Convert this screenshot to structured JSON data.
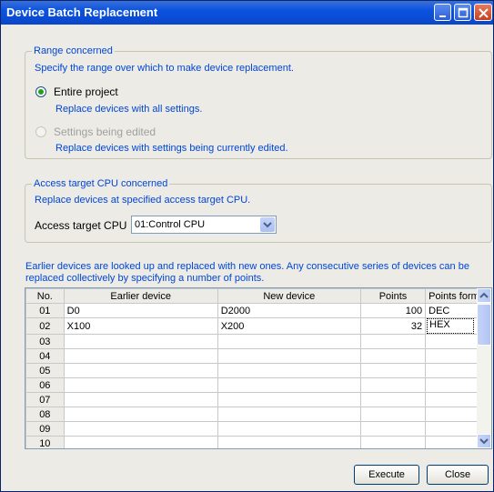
{
  "window": {
    "title": "Device Batch Replacement"
  },
  "range_group": {
    "legend": "Range concerned",
    "description": "Specify the range over which to make device replacement.",
    "options": [
      {
        "label": "Entire project",
        "hint": "Replace devices with all settings.",
        "selected": true,
        "enabled": true
      },
      {
        "label": "Settings being edited",
        "hint": "Replace devices with settings being currently edited.",
        "selected": false,
        "enabled": false
      }
    ]
  },
  "cpu_group": {
    "legend": "Access target CPU concerned",
    "description": "Replace devices at specified access target CPU.",
    "field_label": "Access target CPU",
    "selected_value": "01:Control CPU"
  },
  "instructions": {
    "line1": "Earlier devices are looked up and replaced with new ones. Any consecutive series of devices can be",
    "line2": "replaced collectively by specifying a number of points."
  },
  "table": {
    "columns": [
      "No.",
      "Earlier device",
      "New device",
      "Points",
      "Points format"
    ],
    "rows": [
      {
        "no": "01",
        "earlier": "D0",
        "new": "D2000",
        "points": "100",
        "format": "DEC"
      },
      {
        "no": "02",
        "earlier": "X100",
        "new": "X200",
        "points": "32",
        "format": "HEX"
      },
      {
        "no": "03",
        "earlier": "",
        "new": "",
        "points": "",
        "format": ""
      },
      {
        "no": "04",
        "earlier": "",
        "new": "",
        "points": "",
        "format": ""
      },
      {
        "no": "05",
        "earlier": "",
        "new": "",
        "points": "",
        "format": ""
      },
      {
        "no": "06",
        "earlier": "",
        "new": "",
        "points": "",
        "format": ""
      },
      {
        "no": "07",
        "earlier": "",
        "new": "",
        "points": "",
        "format": ""
      },
      {
        "no": "08",
        "earlier": "",
        "new": "",
        "points": "",
        "format": ""
      },
      {
        "no": "09",
        "earlier": "",
        "new": "",
        "points": "",
        "format": ""
      },
      {
        "no": "10",
        "earlier": "",
        "new": "",
        "points": "",
        "format": ""
      }
    ]
  },
  "buttons": {
    "execute": "Execute",
    "close": "Close"
  },
  "colors": {
    "title_bar": "#0a53e0",
    "group_text": "#0046d5",
    "dialog_bg": "#ecebe6"
  }
}
